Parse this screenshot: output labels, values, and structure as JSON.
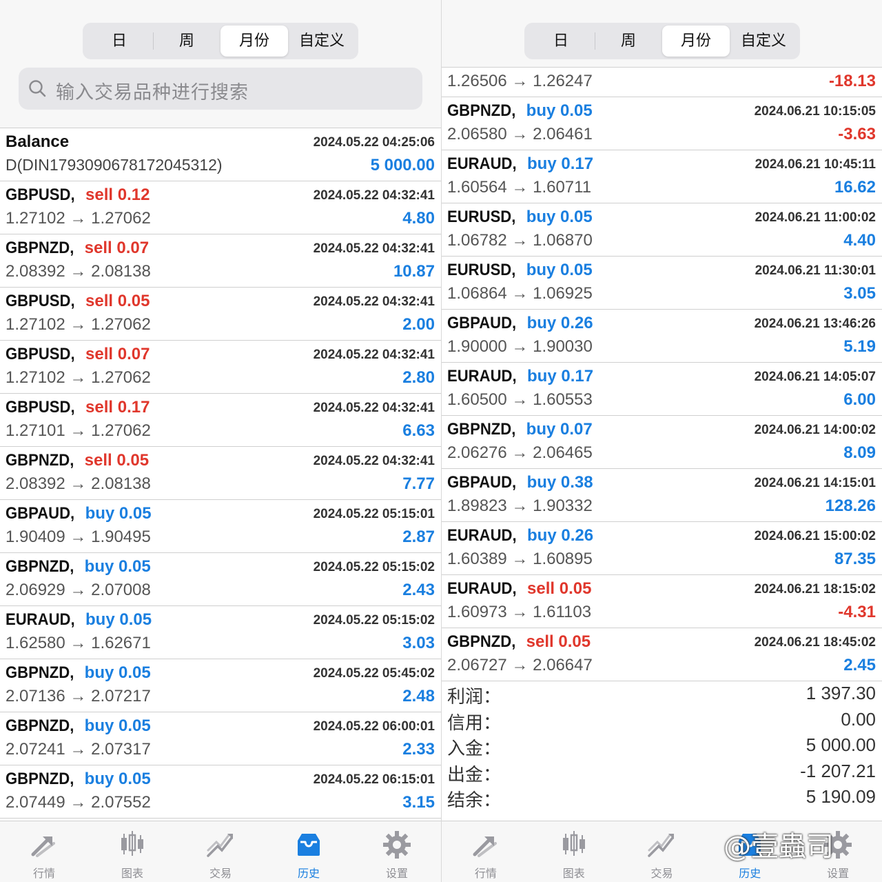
{
  "segments": [
    "日",
    "周",
    "月份",
    "自定义"
  ],
  "active_segment": "月份",
  "search_placeholder": "输入交易品种进行搜索",
  "left": {
    "balance": {
      "label": "Balance",
      "time": "2024.05.22 04:25:06",
      "id": "D(DIN17930906781720453­12)",
      "amount": "5 000.00"
    },
    "rows": [
      {
        "symbol": "GBPUSD,",
        "side": "sell 0.12",
        "dir": "sell",
        "time": "2024.05.22 04:32:41",
        "prices": "1.27102 → 1.27062",
        "profit": "4.80",
        "sign": "pos"
      },
      {
        "symbol": "GBPNZD,",
        "side": "sell 0.07",
        "dir": "sell",
        "time": "2024.05.22 04:32:41",
        "prices": "2.08392 → 2.08138",
        "profit": "10.87",
        "sign": "pos"
      },
      {
        "symbol": "GBPUSD,",
        "side": "sell 0.05",
        "dir": "sell",
        "time": "2024.05.22 04:32:41",
        "prices": "1.27102 → 1.27062",
        "profit": "2.00",
        "sign": "pos"
      },
      {
        "symbol": "GBPUSD,",
        "side": "sell 0.07",
        "dir": "sell",
        "time": "2024.05.22 04:32:41",
        "prices": "1.27102 → 1.27062",
        "profit": "2.80",
        "sign": "pos"
      },
      {
        "symbol": "GBPUSD,",
        "side": "sell 0.17",
        "dir": "sell",
        "time": "2024.05.22 04:32:41",
        "prices": "1.27101 → 1.27062",
        "profit": "6.63",
        "sign": "pos"
      },
      {
        "symbol": "GBPNZD,",
        "side": "sell 0.05",
        "dir": "sell",
        "time": "2024.05.22 04:32:41",
        "prices": "2.08392 → 2.08138",
        "profit": "7.77",
        "sign": "pos"
      },
      {
        "symbol": "GBPAUD,",
        "side": "buy 0.05",
        "dir": "buy",
        "time": "2024.05.22 05:15:01",
        "prices": "1.90409 → 1.90495",
        "profit": "2.87",
        "sign": "pos"
      },
      {
        "symbol": "GBPNZD,",
        "side": "buy 0.05",
        "dir": "buy",
        "time": "2024.05.22 05:15:02",
        "prices": "2.06929 → 2.07008",
        "profit": "2.43",
        "sign": "pos"
      },
      {
        "symbol": "EURAUD,",
        "side": "buy 0.05",
        "dir": "buy",
        "time": "2024.05.22 05:15:02",
        "prices": "1.62580 → 1.62671",
        "profit": "3.03",
        "sign": "pos"
      },
      {
        "symbol": "GBPNZD,",
        "side": "buy 0.05",
        "dir": "buy",
        "time": "2024.05.22 05:45:02",
        "prices": "2.07136 → 2.07217",
        "profit": "2.48",
        "sign": "pos"
      },
      {
        "symbol": "GBPNZD,",
        "side": "buy 0.05",
        "dir": "buy",
        "time": "2024.05.22 06:00:01",
        "prices": "2.07241 → 2.07317",
        "profit": "2.33",
        "sign": "pos"
      },
      {
        "symbol": "GBPNZD,",
        "side": "buy 0.05",
        "dir": "buy",
        "time": "2024.05.22 06:15:01",
        "prices": "2.07449 → 2.07552",
        "profit": "3.15",
        "sign": "pos"
      }
    ]
  },
  "right": {
    "rows": [
      {
        "symbol": "",
        "side": "",
        "dir": "buy",
        "time": "",
        "prices": "1.26506 → 1.26247",
        "profit": "-18.13",
        "sign": "neg"
      },
      {
        "symbol": "GBPNZD,",
        "side": "buy 0.05",
        "dir": "buy",
        "time": "2024.06.21 10:15:05",
        "prices": "2.06580 → 2.06461",
        "profit": "-3.63",
        "sign": "neg"
      },
      {
        "symbol": "EURAUD,",
        "side": "buy 0.17",
        "dir": "buy",
        "time": "2024.06.21 10:45:11",
        "prices": "1.60564 → 1.60711",
        "profit": "16.62",
        "sign": "pos"
      },
      {
        "symbol": "EURUSD,",
        "side": "buy 0.05",
        "dir": "buy",
        "time": "2024.06.21 11:00:02",
        "prices": "1.06782 → 1.06870",
        "profit": "4.40",
        "sign": "pos"
      },
      {
        "symbol": "EURUSD,",
        "side": "buy 0.05",
        "dir": "buy",
        "time": "2024.06.21 11:30:01",
        "prices": "1.06864 → 1.06925",
        "profit": "3.05",
        "sign": "pos"
      },
      {
        "symbol": "GBPAUD,",
        "side": "buy 0.26",
        "dir": "buy",
        "time": "2024.06.21 13:46:26",
        "prices": "1.90000 → 1.90030",
        "profit": "5.19",
        "sign": "pos"
      },
      {
        "symbol": "EURAUD,",
        "side": "buy 0.17",
        "dir": "buy",
        "time": "2024.06.21 14:05:07",
        "prices": "1.60500 → 1.60553",
        "profit": "6.00",
        "sign": "pos"
      },
      {
        "symbol": "GBPNZD,",
        "side": "buy 0.07",
        "dir": "buy",
        "time": "2024.06.21 14:00:02",
        "prices": "2.06276 → 2.06465",
        "profit": "8.09",
        "sign": "pos"
      },
      {
        "symbol": "GBPAUD,",
        "side": "buy 0.38",
        "dir": "buy",
        "time": "2024.06.21 14:15:01",
        "prices": "1.89823 → 1.90332",
        "profit": "128.26",
        "sign": "pos"
      },
      {
        "symbol": "EURAUD,",
        "side": "buy 0.26",
        "dir": "buy",
        "time": "2024.06.21 15:00:02",
        "prices": "1.60389 → 1.60895",
        "profit": "87.35",
        "sign": "pos"
      },
      {
        "symbol": "EURAUD,",
        "side": "sell 0.05",
        "dir": "sell",
        "time": "2024.06.21 18:15:02",
        "prices": "1.60973 → 1.61103",
        "profit": "-4.31",
        "sign": "neg"
      },
      {
        "symbol": "GBPNZD,",
        "side": "sell 0.05",
        "dir": "sell",
        "time": "2024.06.21 18:45:02",
        "prices": "2.06727 → 2.06647",
        "profit": "2.45",
        "sign": "pos"
      }
    ],
    "summary": [
      {
        "label": "利润：",
        "value": "1 397.30"
      },
      {
        "label": "信用：",
        "value": "0.00"
      },
      {
        "label": "入金：",
        "value": "5 000.00"
      },
      {
        "label": "出金：",
        "value": "-1 207.21"
      },
      {
        "label": "结余：",
        "value": "5 190.09"
      }
    ]
  },
  "tabs": [
    {
      "label": "行情",
      "icon": "quotes-icon"
    },
    {
      "label": "图表",
      "icon": "chart-icon"
    },
    {
      "label": "交易",
      "icon": "trade-icon"
    },
    {
      "label": "历史",
      "icon": "history-icon",
      "active": true
    },
    {
      "label": "设置",
      "icon": "settings-icon"
    }
  ],
  "colors": {
    "buy": "#1a7fe0",
    "sell": "#e0372c",
    "active_tab": "#1a7fe0",
    "inactive_tab": "#8e8e93"
  },
  "watermark": "@壹蟲司"
}
